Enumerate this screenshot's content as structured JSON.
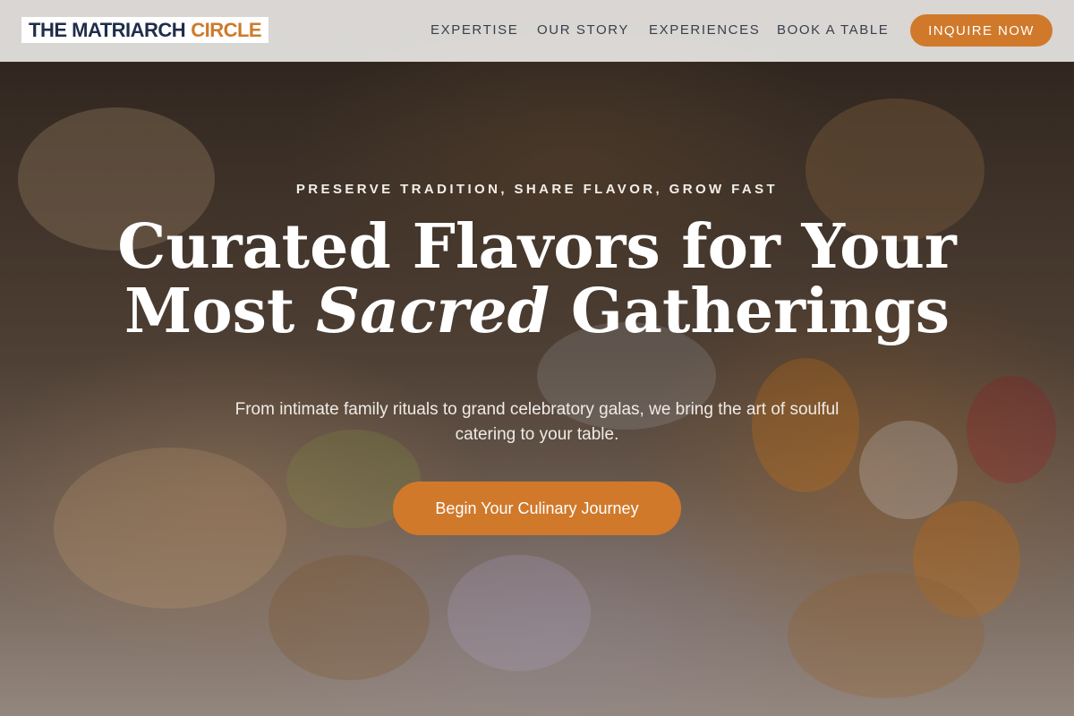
{
  "brand": {
    "name_primary": "THE MATRIARCH",
    "name_accent": "CIRCLE",
    "accent_color": "#d0792b",
    "primary_color": "#1f2d4a"
  },
  "nav": {
    "items": [
      {
        "label": "EXPERTISE"
      },
      {
        "label": "OUR STORY"
      },
      {
        "label": "EXPERIENCES"
      },
      {
        "label": "BOOK A TABLE"
      }
    ],
    "cta_label": "INQUIRE NOW"
  },
  "hero": {
    "eyebrow": "PRESERVE TRADITION, SHARE FLAVOR, GROW FAST",
    "headline_line1": "Curated Flavors for Your",
    "headline_line2_start": "Most",
    "headline_line2_emphasis": "Sacred",
    "headline_line2_end": "Gatherings",
    "subtext": "From intimate family rituals to grand celebratory galas, we bring the art of soulful catering to your table.",
    "cta_label": "Begin Your Culinary Journey",
    "background_image": "catered appetizers and hors d'oeuvres on a buffet table"
  }
}
